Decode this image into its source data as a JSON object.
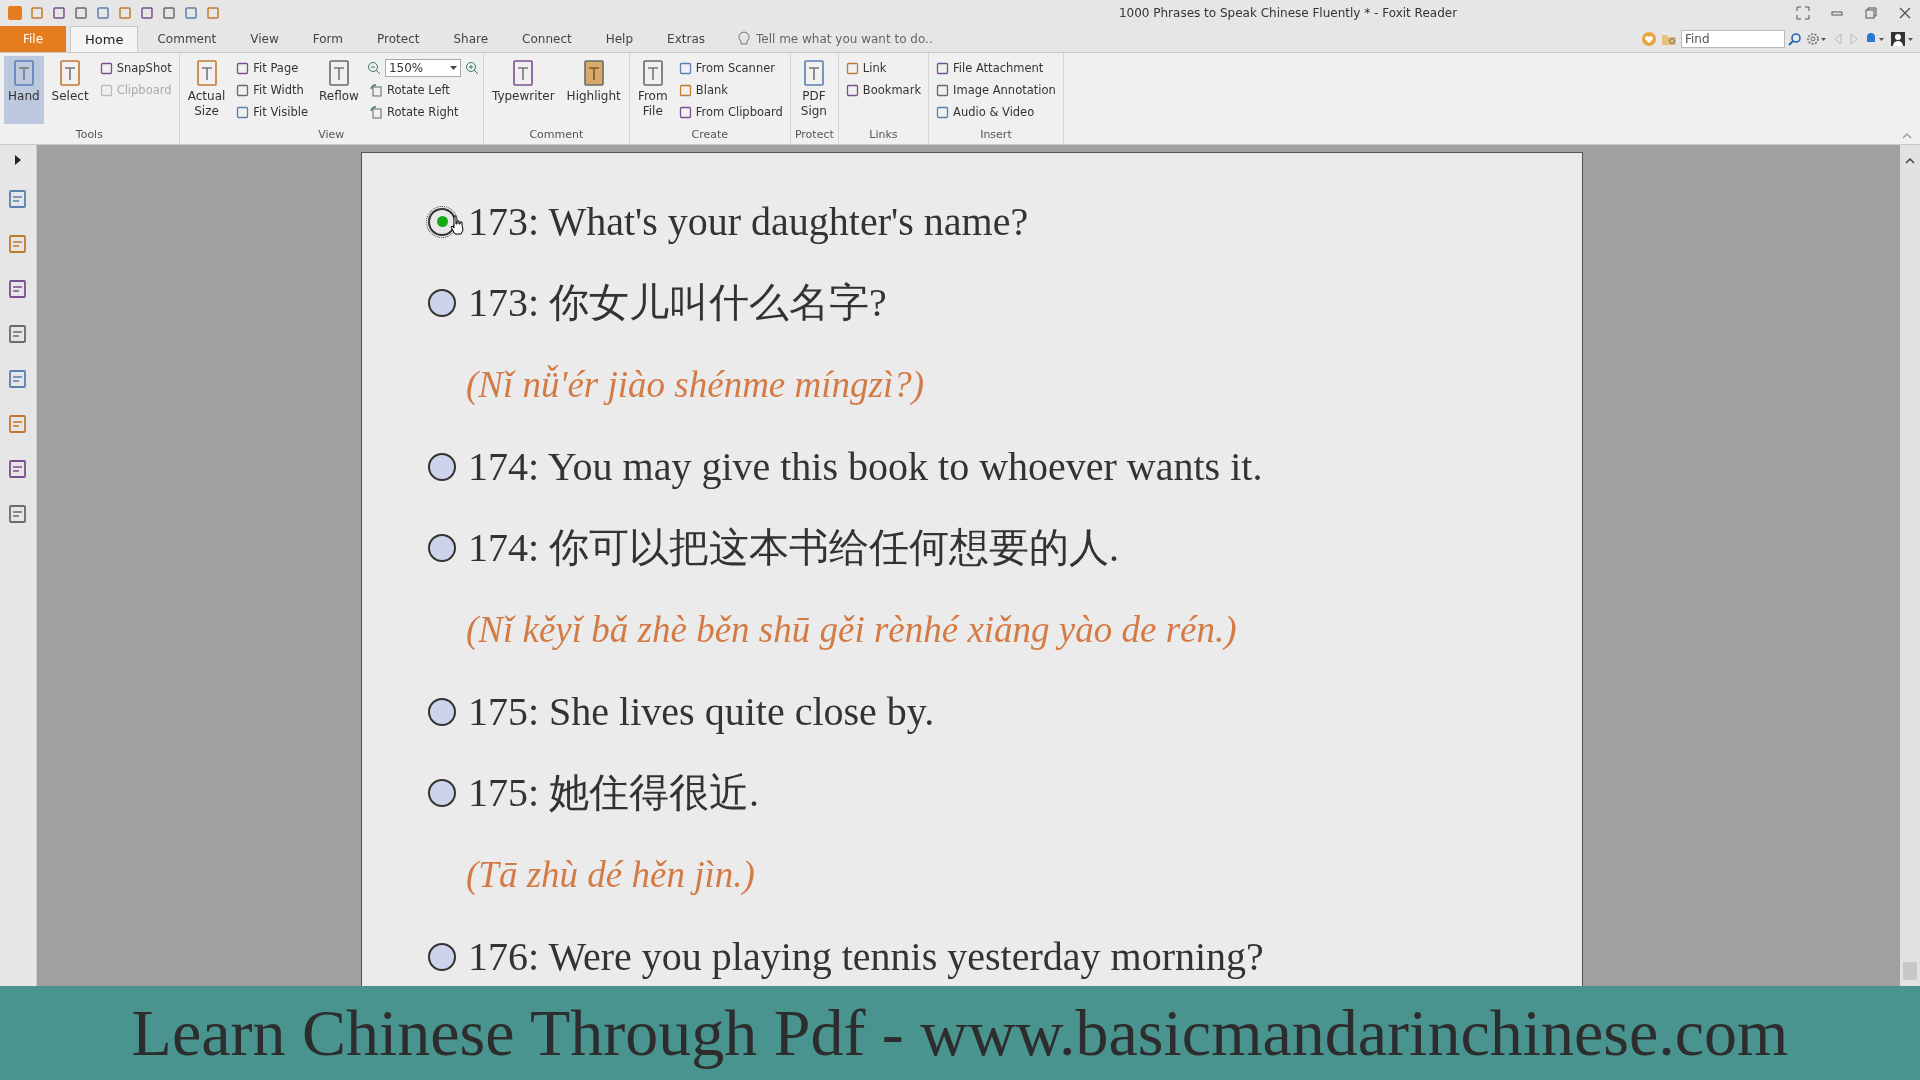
{
  "window": {
    "title": "1000 Phrases to Speak Chinese Fluently * - Foxit Reader"
  },
  "tabs": [
    {
      "label": "File",
      "kind": "file",
      "selected": false
    },
    {
      "label": "Home",
      "kind": "tab",
      "selected": true
    },
    {
      "label": "Comment",
      "kind": "tab",
      "selected": false
    },
    {
      "label": "View",
      "kind": "tab",
      "selected": false
    },
    {
      "label": "Form",
      "kind": "tab",
      "selected": false
    },
    {
      "label": "Protect",
      "kind": "tab",
      "selected": false
    },
    {
      "label": "Share",
      "kind": "tab",
      "selected": false
    },
    {
      "label": "Connect",
      "kind": "tab",
      "selected": false
    },
    {
      "label": "Help",
      "kind": "tab",
      "selected": false
    },
    {
      "label": "Extras",
      "kind": "tab",
      "selected": false
    }
  ],
  "tell_me": {
    "placeholder": "Tell me what you want to do.."
  },
  "find": {
    "placeholder": "Find"
  },
  "ribbon": [
    {
      "label": "Tools",
      "columns": [
        {
          "kind": "large",
          "label": "Hand",
          "selected": true
        },
        {
          "kind": "large",
          "label": "Select",
          "selected": false
        },
        {
          "kind": "small",
          "items": [
            {
              "label": "SnapShot",
              "disabled": false
            },
            {
              "label": "Clipboard",
              "disabled": true
            }
          ]
        }
      ]
    },
    {
      "label": "View",
      "columns": [
        {
          "kind": "large",
          "label": "Actual Size",
          "selected": false
        },
        {
          "kind": "small",
          "items": [
            {
              "label": "Fit Page",
              "disabled": false
            },
            {
              "label": "Fit Width",
              "disabled": false
            },
            {
              "label": "Fit Visible",
              "disabled": false
            }
          ]
        },
        {
          "kind": "large",
          "label": "Reflow",
          "selected": false
        },
        {
          "kind": "zoom",
          "value": "150%",
          "items": [
            {
              "label": "Rotate Left",
              "disabled": false
            },
            {
              "label": "Rotate Right",
              "disabled": false
            }
          ]
        }
      ]
    },
    {
      "label": "Comment",
      "columns": [
        {
          "kind": "large",
          "label": "Typewriter",
          "selected": false
        },
        {
          "kind": "large",
          "label": "Highlight",
          "selected": false
        }
      ]
    },
    {
      "label": "Create",
      "columns": [
        {
          "kind": "large",
          "label": "From File",
          "selected": false
        },
        {
          "kind": "small",
          "items": [
            {
              "label": "From Scanner",
              "disabled": false
            },
            {
              "label": "Blank",
              "disabled": false
            },
            {
              "label": "From Clipboard",
              "disabled": false
            }
          ]
        }
      ]
    },
    {
      "label": "Protect",
      "columns": [
        {
          "kind": "large",
          "label": "PDF Sign",
          "selected": false
        }
      ]
    },
    {
      "label": "Links",
      "columns": [
        {
          "kind": "small",
          "items": [
            {
              "label": "Link",
              "disabled": false
            },
            {
              "label": "Bookmark",
              "disabled": false
            }
          ]
        }
      ]
    },
    {
      "label": "Insert",
      "columns": [
        {
          "kind": "small",
          "items": [
            {
              "label": "File Attachment",
              "disabled": false
            },
            {
              "label": "Image Annotation",
              "disabled": false
            },
            {
              "label": "Audio & Video",
              "disabled": false
            }
          ]
        }
      ]
    }
  ],
  "document": {
    "rows": [
      {
        "kind": "phrase",
        "text": "173: What's your daughter's name?",
        "selected": true
      },
      {
        "kind": "phrase",
        "text": "173: 你女儿叫什么名字?",
        "selected": false
      },
      {
        "kind": "pinyin",
        "text": "(Nǐ nǚ'ér jiào shénme míngzì?)"
      },
      {
        "kind": "phrase",
        "text": "174: You may give this book to whoever wants it.",
        "selected": false
      },
      {
        "kind": "phrase",
        "text": "174: 你可以把这本书给任何想要的人.",
        "selected": false
      },
      {
        "kind": "pinyin",
        "text": "(Nǐ kěyǐ bǎ zhè běn shū gěi rènhé xiǎng yào de rén.)"
      },
      {
        "kind": "phrase",
        "text": "175: She lives quite close by.",
        "selected": false
      },
      {
        "kind": "phrase",
        "text": "175: 她住得很近.",
        "selected": false
      },
      {
        "kind": "pinyin",
        "text": "(Tā zhù dé hěn jìn.)"
      },
      {
        "kind": "phrase",
        "text": "176: Were you playing tennis yesterday morning?",
        "selected": false
      }
    ]
  },
  "banner": {
    "text": "Learn Chinese Through Pdf - www.basicmandarinchinese.com"
  }
}
